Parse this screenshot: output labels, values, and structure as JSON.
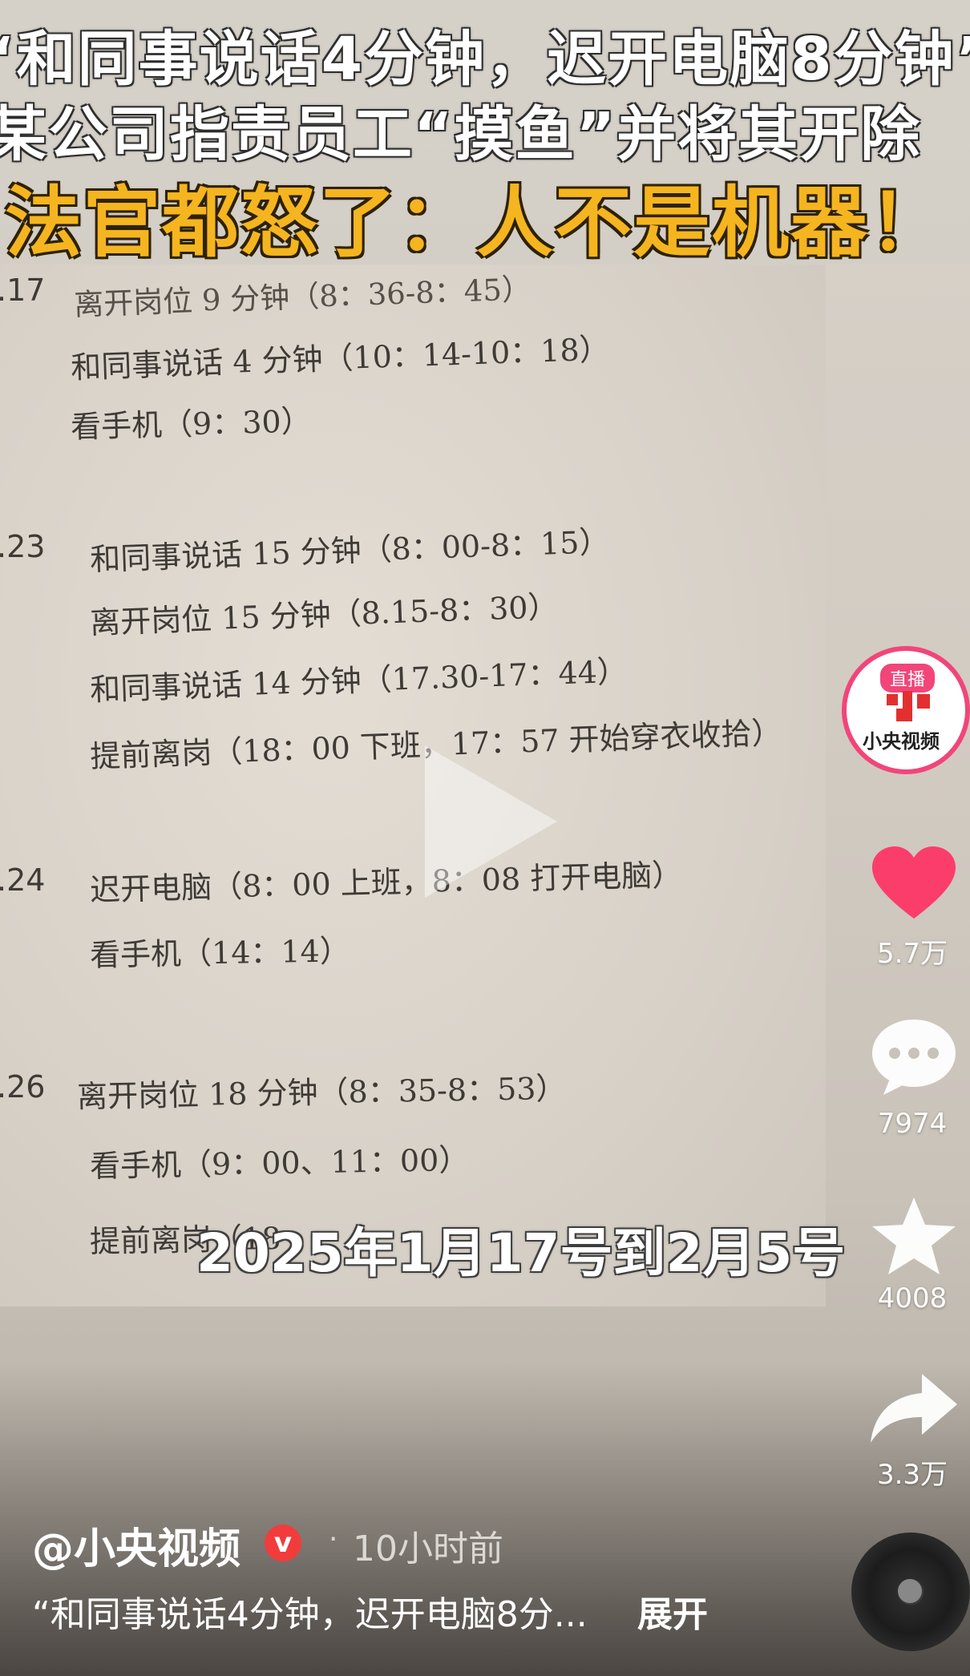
{
  "headline": {
    "line1": "“和同事说话4分钟，迟开电脑8分钟”",
    "line2": "某公司指责员工“摸鱼”并将其开除",
    "line3": "法官都怒了：人不是机器！"
  },
  "document": {
    "entries": [
      {
        "date": ".17",
        "lines": [
          "离开岗位 9 分钟（8：36-8：45）",
          "和同事说话 4 分钟（10：14-10：18）",
          "看手机（9：30）"
        ]
      },
      {
        "date": ".23",
        "lines": [
          "和同事说话 15 分钟（8：00-8：15）",
          "离开岗位 15 分钟（8.15-8：30）",
          "和同事说话 14 分钟（17.30-17：44）",
          "提前离岗（18：00 下班，17：57 开始穿衣收拾）"
        ]
      },
      {
        "date": ".24",
        "lines": [
          "迟开电脑（8：00 上班，8：08 打开电脑）",
          "看手机（14：14）"
        ]
      },
      {
        "date": ".26",
        "lines": [
          "离开岗位 18 分钟（8：35-8：53）",
          "看手机（9：00、11：00）",
          "提前离岗（18：00 下班，17：56 离开岗位）"
        ]
      }
    ]
  },
  "subtitle": "2025年1月17号到2月5号",
  "sidebar": {
    "live_badge": "直播",
    "channel_name": "小央视频",
    "likes": "5.7万",
    "comments": "7974",
    "favorites": "4008",
    "shares": "3.3万"
  },
  "footer": {
    "author": "@小央视频",
    "verified_mark": "v",
    "separator": "·",
    "time": "10小时前",
    "description": "“和同事说话4分钟，迟开电脑8分...",
    "expand": "展开"
  },
  "colors": {
    "accent_pink": "#f2457a",
    "headline_yellow": "#f5b520",
    "verified_red": "#f23c3c"
  }
}
